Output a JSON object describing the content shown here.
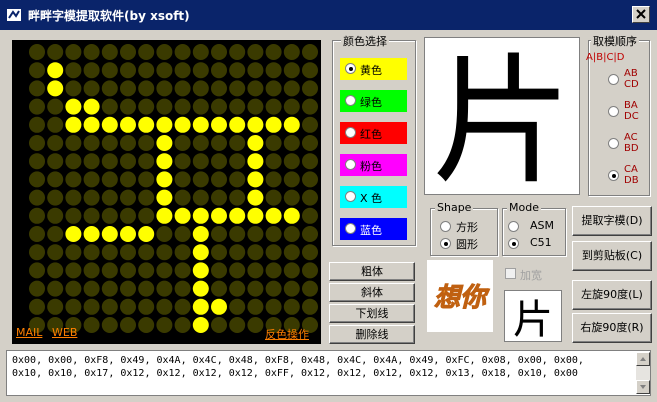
{
  "window": {
    "title": "畔畔字模提取软件(by xsoft)"
  },
  "matrix": {
    "rows": [
      "0000000000000000",
      "0100000000000000",
      "0100000000000000",
      "0011000000000000",
      "0011111111111110",
      "0000000100001000",
      "0000000100001000",
      "0000000100001000",
      "0000000100001000",
      "0000000111111110",
      "0011111001000000",
      "0000000001000000",
      "0000000001000000",
      "0000000001000000",
      "0000000001100000",
      "0000000001000000"
    ],
    "on_color": "#ffff00",
    "off_color": "#3a3a00",
    "links": {
      "mail": "MAIL",
      "web": "WEB",
      "invert": "反色操作"
    }
  },
  "color_select": {
    "label": "颜色选择",
    "options": [
      {
        "label": "黄色",
        "color": "#ffff00",
        "selected": true
      },
      {
        "label": "绿色",
        "color": "#00ff00",
        "selected": false
      },
      {
        "label": "红色",
        "color": "#ff0000",
        "selected": false
      },
      {
        "label": "粉色",
        "color": "#ff00ff",
        "selected": false
      },
      {
        "label": "X 色",
        "color": "#00ffff",
        "selected": false
      },
      {
        "label": "蓝色",
        "color": "#0000ff",
        "selected": false
      }
    ]
  },
  "style_buttons": {
    "bold": "粗体",
    "italic": "斜体",
    "underline": "下划线",
    "strike": "删除线"
  },
  "preview": {
    "char": "片"
  },
  "order": {
    "label": "取模顺序",
    "indicator": "A|B|C|D",
    "options": [
      {
        "line1": "AB",
        "line2": "CD",
        "selected": false
      },
      {
        "line1": "BA",
        "line2": "DC",
        "selected": false
      },
      {
        "line1": "AC",
        "line2": "BD",
        "selected": false
      },
      {
        "line1": "CA",
        "line2": "DB",
        "selected": true
      }
    ]
  },
  "shape": {
    "label": "Shape",
    "square": "方形",
    "circle": "圆形",
    "selected": "circle"
  },
  "mode": {
    "label": "Mode",
    "asm": "ASM",
    "c51": "C51",
    "selected": "c51"
  },
  "bold_check": {
    "label": "加宽",
    "checked": false,
    "enabled": false
  },
  "thumb_text": "想你",
  "mini_char": "片",
  "actions": {
    "extract": "提取字模(D)",
    "clipboard": "到剪贴板(C)",
    "rot_left": "左旋90度(L)",
    "rot_right": "右旋90度(R)"
  },
  "output": {
    "line1": "0x00, 0x00, 0xF8, 0x49, 0x4A, 0x4C, 0x48, 0xF8, 0x48, 0x4C, 0x4A, 0x49, 0xFC, 0x08, 0x00, 0x00,",
    "line2": "0x10, 0x10, 0x17, 0x12, 0x12, 0x12, 0x12, 0xFF, 0x12, 0x12, 0x12, 0x12, 0x13, 0x18, 0x10, 0x00"
  }
}
